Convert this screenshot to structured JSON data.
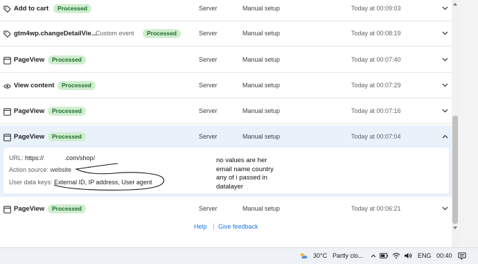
{
  "events": [
    {
      "name": "Add to cart",
      "status": "Processed",
      "source": "Server",
      "setup": "Manual setup",
      "time": "Today at 00:09:03",
      "icon": "cart-tag-icon"
    },
    {
      "name": "gtm4wp.changeDetailVie...",
      "custom_type": "Custom event",
      "status": "Processed",
      "source": "Server",
      "setup": "Manual setup",
      "time": "Today at 00:08:19",
      "icon": "tag-icon"
    },
    {
      "name": "PageView",
      "status": "Processed",
      "source": "Server",
      "setup": "Manual setup",
      "time": "Today at 00:07:40",
      "icon": "browser-window-icon"
    },
    {
      "name": "View content",
      "status": "Processed",
      "source": "Server",
      "setup": "Manual setup",
      "time": "Today at 00:07:29",
      "icon": "eye-icon"
    },
    {
      "name": "PageView",
      "status": "Processed",
      "source": "Server",
      "setup": "Manual setup",
      "time": "Today at 00:07:16",
      "icon": "browser-window-icon"
    },
    {
      "name": "PageView",
      "status": "Processed",
      "source": "Server",
      "setup": "Manual setup",
      "time": "Today at 00:07:04",
      "icon": "browser-window-icon"
    }
  ],
  "details": {
    "url_label": "URL:",
    "url_prefix": "https://",
    "url_suffix": ".com/shop/",
    "action_label": "Action source:",
    "action_value": "website",
    "keys_label": "User data keys:",
    "keys_value": "External ID, IP address, User agent"
  },
  "last_event": {
    "name": "PageView",
    "status": "Processed",
    "source": "Server",
    "setup": "Manual setup",
    "time": "Today at 00:06:21",
    "icon": "browser-window-icon"
  },
  "footer": {
    "help": "Help",
    "separator": "|",
    "feedback": "Give feedback"
  },
  "annotation": "no values are her\nemail name country\nany of i passed in\ndatalayer",
  "taskbar": {
    "temperature": "30°C",
    "weather": "Partly clo...",
    "language": "ENG",
    "clock": "00:40"
  },
  "colors": {
    "accent": "#1a73e8",
    "badge_bg": "#cfeecf",
    "badge_text": "#1e6b2e",
    "selected_row": "#e9f1fb"
  }
}
